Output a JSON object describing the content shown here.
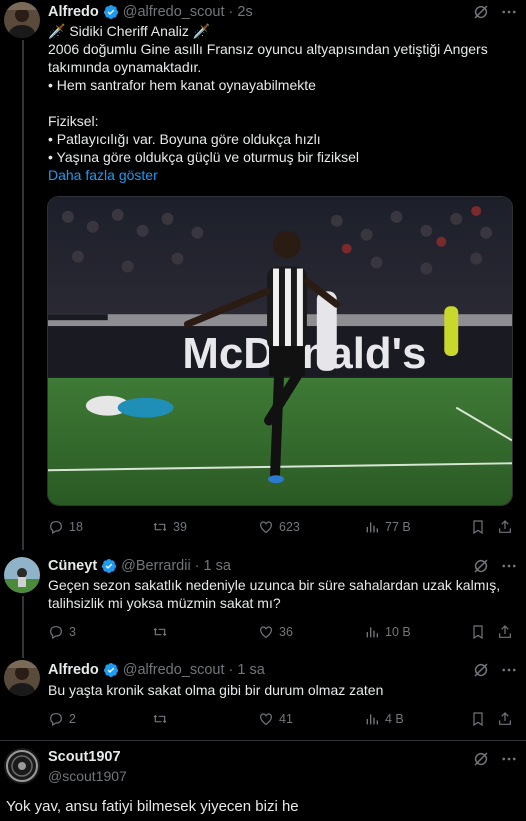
{
  "tweet1": {
    "name": "Alfredo",
    "handle": "@alfredo_scout",
    "time": "2s",
    "lines": [
      "🗡️ Sidiki Cheriff Analiz 🗡️",
      "2006 doğumlu Gine asıllı Fransız oyuncu altyapısından yetiştiği Angers",
      "takımında oynamaktadır.",
      "• Hem santrafor hem kanat oynayabilmekte",
      "",
      "Fiziksel:",
      "• Patlayıcılığı var. Boyuna göre oldukça hızlı",
      "• Yaşına göre oldukça güçlü ve oturmuş bir fiziksel"
    ],
    "show_more": "Daha fazla göster",
    "media_text": "McDonald's",
    "actions": {
      "replies": "18",
      "retweets": "39",
      "likes": "623",
      "views": "77 B"
    }
  },
  "tweet2": {
    "name": "Cüneyt",
    "handle": "@Berrardii",
    "time": "1 sa",
    "lines": [
      "Geçen sezon sakatlık nedeniyle uzunca bir süre sahalardan uzak kalmış,",
      "talihsizlik mi yoksa müzmin sakat mı?"
    ],
    "actions": {
      "replies": "3",
      "retweets": "",
      "likes": "36",
      "views": "10 B"
    }
  },
  "tweet3": {
    "name": "Alfredo",
    "handle": "@alfredo_scout",
    "time": "1 sa",
    "lines": [
      "Bu yaşta kronik sakat olma gibi bir durum olmaz zaten"
    ],
    "actions": {
      "replies": "2",
      "retweets": "",
      "likes": "41",
      "views": "4 B"
    }
  },
  "tweet4": {
    "name": "Scout1907",
    "handle": "@scout1907",
    "text": "Yok yav, ansu fatiyi bilmesek yiyecen bizi he"
  },
  "colors": {
    "accent": "#1d9bf0",
    "muted": "#71767b",
    "background": "#000000",
    "text": "#e7e9ea"
  },
  "icons": [
    "grok-icon",
    "more-icon",
    "reply-icon",
    "retweet-icon",
    "like-icon",
    "views-icon",
    "bookmark-icon",
    "share-icon",
    "verified-badge-icon"
  ]
}
